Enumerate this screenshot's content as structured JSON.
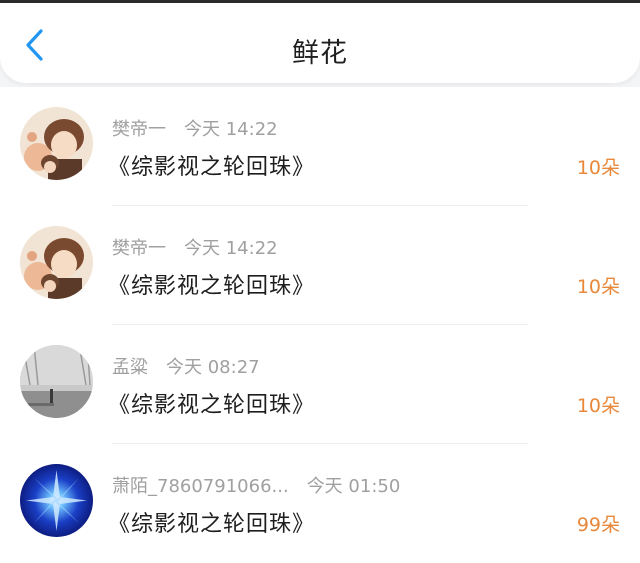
{
  "header": {
    "title": "鲜花",
    "back_icon": "back-chevron-icon"
  },
  "colors": {
    "accent": "#2196f3",
    "count": "#e8883a",
    "meta": "#a0a0a0"
  },
  "records": [
    {
      "user": "樊帝一",
      "time": "今天 14:22",
      "book": "《综影视之轮回珠》",
      "count": "10朵",
      "avatar": "anime-avatar"
    },
    {
      "user": "樊帝一",
      "time": "今天 14:22",
      "book": "《综影视之轮回珠》",
      "count": "10朵",
      "avatar": "anime-avatar"
    },
    {
      "user": "孟粱",
      "time": "今天 08:27",
      "book": "《综影视之轮回珠》",
      "count": "10朵",
      "avatar": "grey-landscape-avatar"
    },
    {
      "user": "萧陌_7860791066...",
      "time": "今天 01:50",
      "book": "《综影视之轮回珠》",
      "count": "99朵",
      "avatar": "blue-star-avatar"
    }
  ]
}
